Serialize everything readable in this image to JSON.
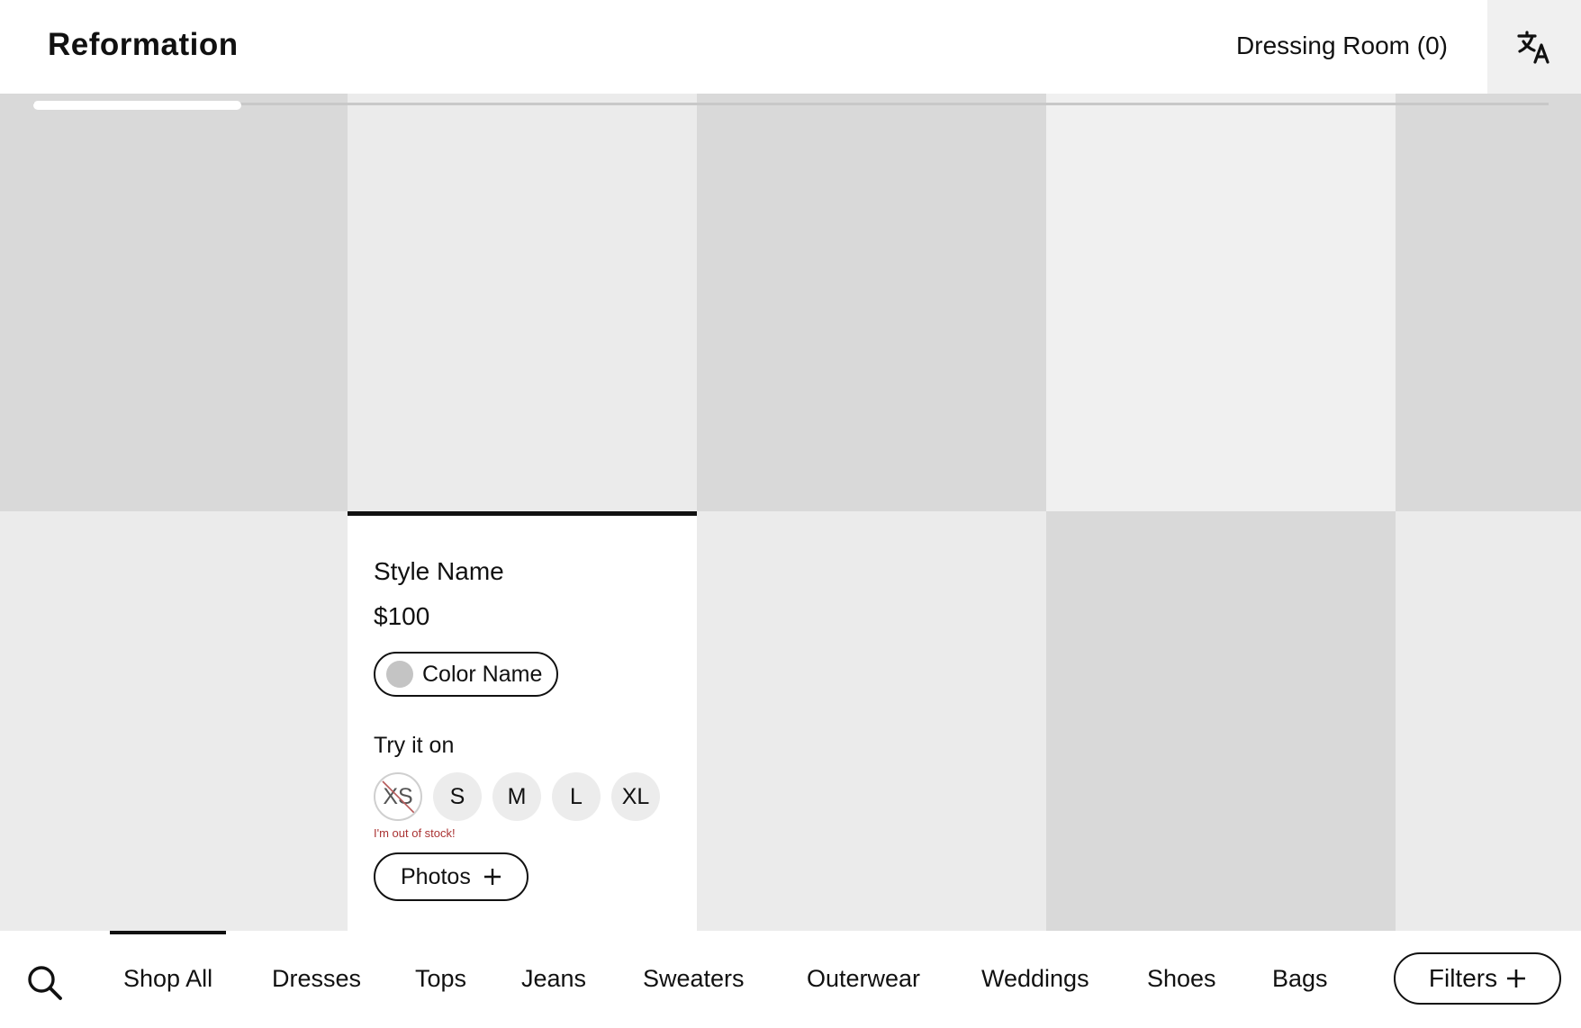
{
  "header": {
    "logo": "Reformation",
    "dressing_room": "Dressing Room (0)",
    "translate_icon": "translate-icon"
  },
  "product": {
    "style_name": "Style Name",
    "price": "$100",
    "color_name": "Color Name",
    "try_label": "Try it on",
    "sizes": [
      {
        "label": "XS",
        "available": false
      },
      {
        "label": "S",
        "available": true
      },
      {
        "label": "M",
        "available": true
      },
      {
        "label": "L",
        "available": true
      },
      {
        "label": "XL",
        "available": true
      }
    ],
    "out_of_stock_msg": "I'm out of stock!",
    "photos_label": "Photos",
    "swatch_color": "#c4c4c4"
  },
  "nav": {
    "items": [
      "Shop All",
      "Dresses",
      "Tops",
      "Jeans",
      "Sweaters",
      "Outerwear",
      "Weddings",
      "Shoes",
      "Bags"
    ],
    "active": "Shop All",
    "filters_label": "Filters"
  },
  "colors": {
    "tile_dark": "#d9d9d9",
    "tile_light": "#ebebeb",
    "tile_lighter": "#f0f0f0",
    "accent": "#111111",
    "error": "#a33333"
  }
}
